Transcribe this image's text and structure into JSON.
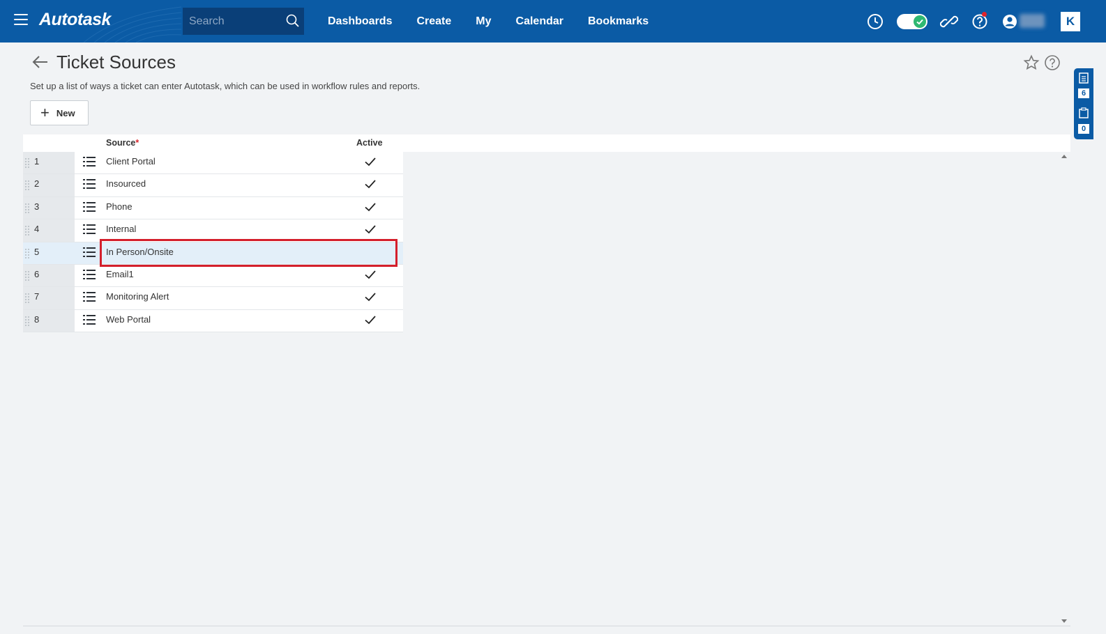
{
  "app": {
    "logo": "Autotask",
    "brand_mark": "K"
  },
  "topbar": {
    "search_placeholder": "Search",
    "nav": [
      "Dashboards",
      "Create",
      "My",
      "Calendar",
      "Bookmarks"
    ],
    "icons": [
      "clock-icon",
      "toggle-switch",
      "link-icon",
      "help-icon",
      "user-icon"
    ],
    "accent_color": "#0b5ba5"
  },
  "page": {
    "title": "Ticket Sources",
    "description": "Set up a list of ways a ticket can enter Autotask, which can be used in workflow rules and reports.",
    "new_button": "New"
  },
  "side_panel": {
    "notes_count": "6",
    "clipboard_count": "0"
  },
  "grid": {
    "columns": {
      "source": "Source",
      "required_marker": "*",
      "active": "Active"
    },
    "rows": [
      {
        "num": "1",
        "source": "Client Portal",
        "active": true
      },
      {
        "num": "2",
        "source": "Insourced",
        "active": true
      },
      {
        "num": "3",
        "source": "Phone",
        "active": true
      },
      {
        "num": "4",
        "source": "Internal",
        "active": true
      },
      {
        "num": "5",
        "source": "In Person/Onsite",
        "active": false,
        "selected": true
      },
      {
        "num": "6",
        "source": "Email1",
        "active": true
      },
      {
        "num": "7",
        "source": "Monitoring Alert",
        "active": true
      },
      {
        "num": "8",
        "source": "Web Portal",
        "active": true
      }
    ]
  }
}
